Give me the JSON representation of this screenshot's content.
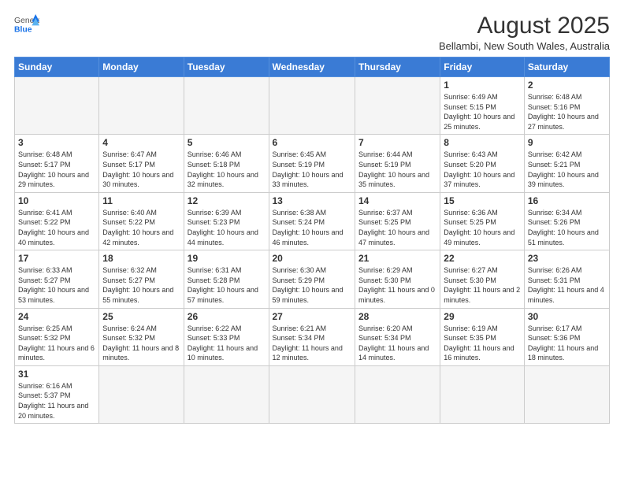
{
  "logo": {
    "text_general": "General",
    "text_blue": "Blue"
  },
  "title": "August 2025",
  "location": "Bellambi, New South Wales, Australia",
  "days_of_week": [
    "Sunday",
    "Monday",
    "Tuesday",
    "Wednesday",
    "Thursday",
    "Friday",
    "Saturday"
  ],
  "weeks": [
    [
      {
        "day": "",
        "info": ""
      },
      {
        "day": "",
        "info": ""
      },
      {
        "day": "",
        "info": ""
      },
      {
        "day": "",
        "info": ""
      },
      {
        "day": "",
        "info": ""
      },
      {
        "day": "1",
        "info": "Sunrise: 6:49 AM\nSunset: 5:15 PM\nDaylight: 10 hours and 25 minutes."
      },
      {
        "day": "2",
        "info": "Sunrise: 6:48 AM\nSunset: 5:16 PM\nDaylight: 10 hours and 27 minutes."
      }
    ],
    [
      {
        "day": "3",
        "info": "Sunrise: 6:48 AM\nSunset: 5:17 PM\nDaylight: 10 hours and 29 minutes."
      },
      {
        "day": "4",
        "info": "Sunrise: 6:47 AM\nSunset: 5:17 PM\nDaylight: 10 hours and 30 minutes."
      },
      {
        "day": "5",
        "info": "Sunrise: 6:46 AM\nSunset: 5:18 PM\nDaylight: 10 hours and 32 minutes."
      },
      {
        "day": "6",
        "info": "Sunrise: 6:45 AM\nSunset: 5:19 PM\nDaylight: 10 hours and 33 minutes."
      },
      {
        "day": "7",
        "info": "Sunrise: 6:44 AM\nSunset: 5:19 PM\nDaylight: 10 hours and 35 minutes."
      },
      {
        "day": "8",
        "info": "Sunrise: 6:43 AM\nSunset: 5:20 PM\nDaylight: 10 hours and 37 minutes."
      },
      {
        "day": "9",
        "info": "Sunrise: 6:42 AM\nSunset: 5:21 PM\nDaylight: 10 hours and 39 minutes."
      }
    ],
    [
      {
        "day": "10",
        "info": "Sunrise: 6:41 AM\nSunset: 5:22 PM\nDaylight: 10 hours and 40 minutes."
      },
      {
        "day": "11",
        "info": "Sunrise: 6:40 AM\nSunset: 5:22 PM\nDaylight: 10 hours and 42 minutes."
      },
      {
        "day": "12",
        "info": "Sunrise: 6:39 AM\nSunset: 5:23 PM\nDaylight: 10 hours and 44 minutes."
      },
      {
        "day": "13",
        "info": "Sunrise: 6:38 AM\nSunset: 5:24 PM\nDaylight: 10 hours and 46 minutes."
      },
      {
        "day": "14",
        "info": "Sunrise: 6:37 AM\nSunset: 5:25 PM\nDaylight: 10 hours and 47 minutes."
      },
      {
        "day": "15",
        "info": "Sunrise: 6:36 AM\nSunset: 5:25 PM\nDaylight: 10 hours and 49 minutes."
      },
      {
        "day": "16",
        "info": "Sunrise: 6:34 AM\nSunset: 5:26 PM\nDaylight: 10 hours and 51 minutes."
      }
    ],
    [
      {
        "day": "17",
        "info": "Sunrise: 6:33 AM\nSunset: 5:27 PM\nDaylight: 10 hours and 53 minutes."
      },
      {
        "day": "18",
        "info": "Sunrise: 6:32 AM\nSunset: 5:27 PM\nDaylight: 10 hours and 55 minutes."
      },
      {
        "day": "19",
        "info": "Sunrise: 6:31 AM\nSunset: 5:28 PM\nDaylight: 10 hours and 57 minutes."
      },
      {
        "day": "20",
        "info": "Sunrise: 6:30 AM\nSunset: 5:29 PM\nDaylight: 10 hours and 59 minutes."
      },
      {
        "day": "21",
        "info": "Sunrise: 6:29 AM\nSunset: 5:30 PM\nDaylight: 11 hours and 0 minutes."
      },
      {
        "day": "22",
        "info": "Sunrise: 6:27 AM\nSunset: 5:30 PM\nDaylight: 11 hours and 2 minutes."
      },
      {
        "day": "23",
        "info": "Sunrise: 6:26 AM\nSunset: 5:31 PM\nDaylight: 11 hours and 4 minutes."
      }
    ],
    [
      {
        "day": "24",
        "info": "Sunrise: 6:25 AM\nSunset: 5:32 PM\nDaylight: 11 hours and 6 minutes."
      },
      {
        "day": "25",
        "info": "Sunrise: 6:24 AM\nSunset: 5:32 PM\nDaylight: 11 hours and 8 minutes."
      },
      {
        "day": "26",
        "info": "Sunrise: 6:22 AM\nSunset: 5:33 PM\nDaylight: 11 hours and 10 minutes."
      },
      {
        "day": "27",
        "info": "Sunrise: 6:21 AM\nSunset: 5:34 PM\nDaylight: 11 hours and 12 minutes."
      },
      {
        "day": "28",
        "info": "Sunrise: 6:20 AM\nSunset: 5:34 PM\nDaylight: 11 hours and 14 minutes."
      },
      {
        "day": "29",
        "info": "Sunrise: 6:19 AM\nSunset: 5:35 PM\nDaylight: 11 hours and 16 minutes."
      },
      {
        "day": "30",
        "info": "Sunrise: 6:17 AM\nSunset: 5:36 PM\nDaylight: 11 hours and 18 minutes."
      }
    ],
    [
      {
        "day": "31",
        "info": "Sunrise: 6:16 AM\nSunset: 5:37 PM\nDaylight: 11 hours and 20 minutes."
      },
      {
        "day": "",
        "info": ""
      },
      {
        "day": "",
        "info": ""
      },
      {
        "day": "",
        "info": ""
      },
      {
        "day": "",
        "info": ""
      },
      {
        "day": "",
        "info": ""
      },
      {
        "day": "",
        "info": ""
      }
    ]
  ]
}
